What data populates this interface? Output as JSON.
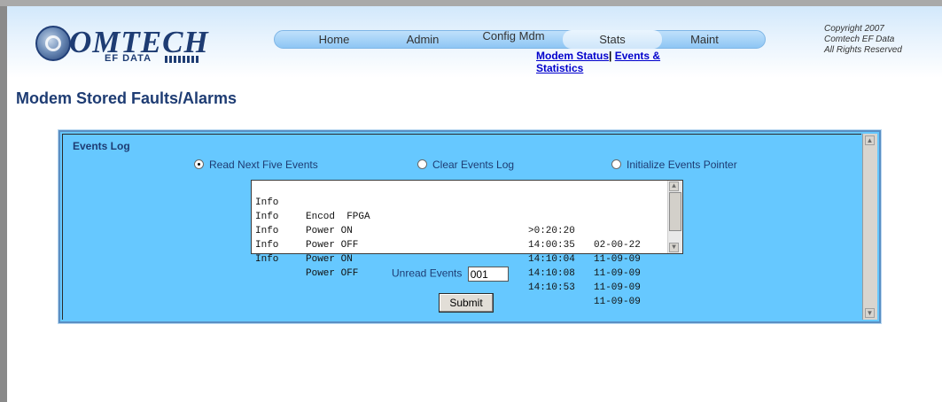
{
  "logo": {
    "word": "OMTECH",
    "sub": "EF DATA"
  },
  "nav": {
    "items": [
      {
        "label": "Home"
      },
      {
        "label": "Admin"
      },
      {
        "label": "Config Mdm"
      },
      {
        "label": "Stats",
        "active": true
      },
      {
        "label": "Maint"
      }
    ]
  },
  "sublinks": {
    "modem_status": "Modem Status",
    "separator": "|",
    "events": "Events &",
    "statistics": "Statistics"
  },
  "copyright": {
    "line1": "Copyright 2007",
    "line2": "Comtech EF Data",
    "line3": "All Rights Reserved"
  },
  "page": {
    "title": "Modem Stored Faults/Alarms"
  },
  "panel": {
    "title": "Events Log",
    "radios": [
      {
        "label": "Read Next Five Events",
        "selected": true
      },
      {
        "label": "Clear Events Log",
        "selected": false
      },
      {
        "label": "Initialize Events Pointer",
        "selected": false
      }
    ],
    "events": [
      {
        "type": "Info",
        "desc": "Encod  FPGA",
        "time": ">0:20:20",
        "date": "02-00-22"
      },
      {
        "type": "Info",
        "desc": "Power ON",
        "time": "14:00:35",
        "date": "11-09-09"
      },
      {
        "type": "Info",
        "desc": "Power OFF",
        "time": "14:10:04",
        "date": "11-09-09"
      },
      {
        "type": "Info",
        "desc": "Power ON",
        "time": "14:10:08",
        "date": "11-09-09"
      },
      {
        "type": "Info",
        "desc": "Power OFF",
        "time": "14:10:53",
        "date": "11-09-09"
      }
    ],
    "unread_label": "Unread Events",
    "unread_value": "001",
    "submit_label": "Submit"
  },
  "colors": {
    "panel_bg": "#66c8ff",
    "title": "#1e3c73",
    "link": "#0000cc"
  }
}
